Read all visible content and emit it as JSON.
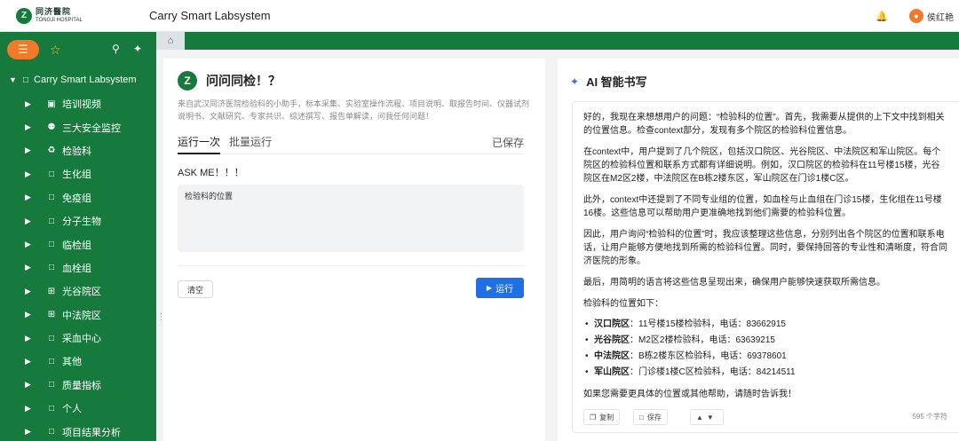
{
  "header": {
    "logo_cn": "同济醫院",
    "logo_en": "TONGJI HOSPITAL",
    "app_title": "Carry  Smart Labsystem",
    "username": "侯红艳"
  },
  "sidebar": {
    "root_label": "Carry  Smart Labsystem",
    "items": [
      {
        "label": "培训视频",
        "icon": "video-icon"
      },
      {
        "label": "三大安全监控",
        "icon": "users-icon"
      },
      {
        "label": "检验科",
        "icon": "recycle-icon"
      },
      {
        "label": "生化组",
        "icon": "folder-icon"
      },
      {
        "label": "免疫组",
        "icon": "folder-icon"
      },
      {
        "label": "分子生物",
        "icon": "folder-icon"
      },
      {
        "label": "临检组",
        "icon": "folder-icon"
      },
      {
        "label": "血栓组",
        "icon": "folder-icon"
      },
      {
        "label": "光谷院区",
        "icon": "grid-icon"
      },
      {
        "label": "中法院区",
        "icon": "grid-icon"
      },
      {
        "label": "采血中心",
        "icon": "folder-icon"
      },
      {
        "label": "其他",
        "icon": "folder-icon"
      },
      {
        "label": "质量指标",
        "icon": "folder-icon"
      },
      {
        "label": "个人",
        "icon": "folder-icon"
      },
      {
        "label": "项目结果分析",
        "icon": "folder-icon"
      }
    ]
  },
  "app": {
    "name": "问问同检！？",
    "description": "来自武汉同济医院检验科的小助手，标本采集、实验室操作流程、项目说明、取报告时间、仪器试剂说明书、文献研究、专家共识、综述撰写、报告单解读，问我任何问题！",
    "tabs": [
      "运行一次",
      "批量运行"
    ],
    "saved_label": "已保存",
    "ask_label": "ASK ME！！！",
    "input_value": "检验科的位置",
    "clear_label": "清空",
    "run_label": "运行"
  },
  "ai": {
    "title": "AI 智能书写",
    "paragraphs": [
      "好的，我现在来想想用户的问题：“检验科的位置”。首先，我需要从提供的上下文中找到相关的位置信息。检查context部分，发现有多个院区的检验科位置信息。",
      "在context中，用户提到了几个院区，包括汉口院区、光谷院区、中法院区和军山院区。每个院区的检验科位置和联系方式都有详细说明。例如，汉口院区的检验科在11号楼15楼，光谷院区在M2区2楼，中法院区在B栋2楼东区，军山院区在门诊1楼C区。",
      "此外，context中还提到了不同专业组的位置，如血栓与止血组在门诊15楼，生化组在11号楼16楼。这些信息可以帮助用户更准确地找到他们需要的检验科位置。",
      "因此，用户询问“检验科的位置”时，我应该整理这些信息，分别列出各个院区的位置和联系电话，让用户能够方便地找到所需的检验科位置。同时，要保持回答的专业性和清晰度，符合同济医院的形象。",
      "最后，用简明的语言将这些信息呈现出来，确保用户能够快速获取所需信息。",
      "检验科的位置如下："
    ],
    "locations": [
      {
        "name": "汉口院区",
        "detail": "：11号楼15楼检验科，电话：83662915"
      },
      {
        "name": "光谷院区",
        "detail": "：M2区2楼检验科，电话：63639215"
      },
      {
        "name": "中法院区",
        "detail": "：B栋2楼东区检验科，电话：69378601"
      },
      {
        "name": "军山院区",
        "detail": "：门诊楼1楼C区检验科，电话：84214511"
      }
    ],
    "closing": "如果您需要更具体的位置或其他帮助，请随时告诉我！",
    "copy_label": "复制",
    "save_label": "保存",
    "char_count": "595 个字符"
  }
}
